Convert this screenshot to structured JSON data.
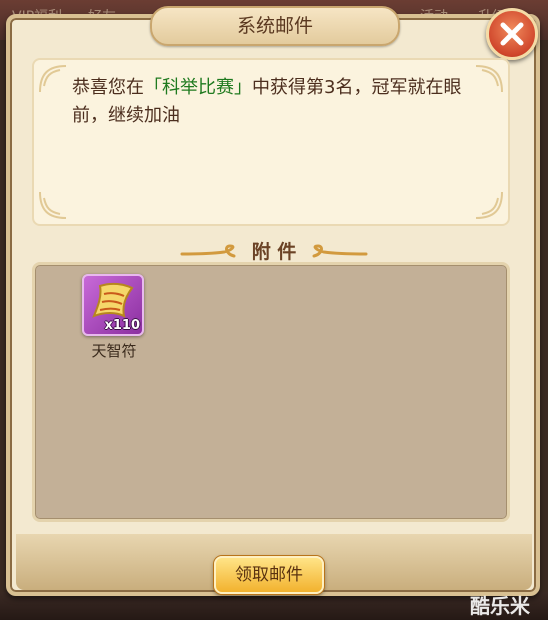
{
  "background": {
    "top_labels": [
      "VIP福利",
      "好友",
      "活动",
      "升级"
    ]
  },
  "dialog": {
    "title": "系统邮件",
    "close_icon": "close-x-icon"
  },
  "message": {
    "prefix": "恭喜您在",
    "highlight": "「科举比赛」",
    "suffix": "中获得第3名，冠军就在眼前，继续加油"
  },
  "attachments": {
    "header": "附 件",
    "items": [
      {
        "name": "天智符",
        "quantity": "x110",
        "icon": "scroll-talisman-icon"
      }
    ]
  },
  "actions": {
    "claim_label": "领取邮件"
  },
  "watermark": "酷乐米",
  "colors": {
    "panel": "#f3e9d0",
    "highlight": "#1f7a1f",
    "close_button": "#d0472c",
    "claim_button": "#f2b22e",
    "item_bg": "#8b2fa0"
  }
}
